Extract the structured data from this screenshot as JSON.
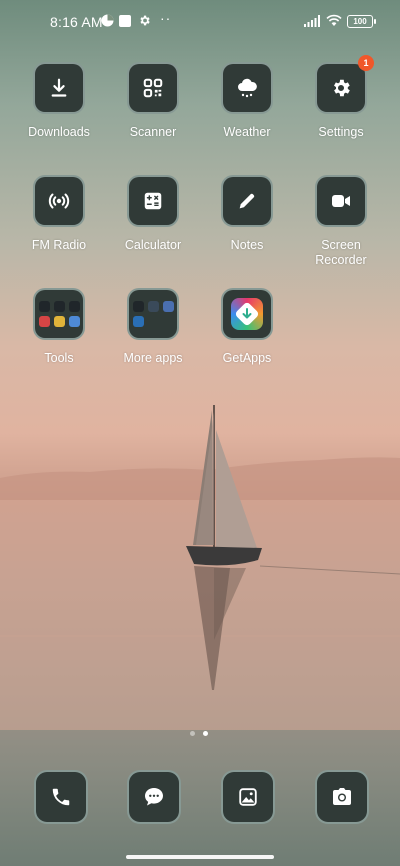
{
  "status_bar": {
    "time": "8:16 AM",
    "battery": "100",
    "more": "··"
  },
  "apps": {
    "row1": [
      {
        "label": "Downloads",
        "icon": "download-icon"
      },
      {
        "label": "Scanner",
        "icon": "qr-scanner-icon"
      },
      {
        "label": "Weather",
        "icon": "weather-cloud-icon"
      },
      {
        "label": "Settings",
        "icon": "gear-icon",
        "badge": "1"
      }
    ],
    "row2": [
      {
        "label": "FM Radio",
        "icon": "radio-icon"
      },
      {
        "label": "Calculator",
        "icon": "calculator-icon"
      },
      {
        "label": "Notes",
        "icon": "pencil-icon"
      },
      {
        "label": "Screen\nRecorder",
        "label_line1": "Screen",
        "label_line2": "Recorder",
        "icon": "video-camera-icon"
      }
    ],
    "row3": [
      {
        "label": "Tools",
        "icon": "folder-icon"
      },
      {
        "label": "More apps",
        "icon": "folder-icon"
      },
      {
        "label": "GetApps",
        "icon": "getapps-icon"
      }
    ]
  },
  "pager": {
    "pages": 2,
    "current": 2
  },
  "dock": [
    {
      "icon": "phone-icon"
    },
    {
      "icon": "message-icon"
    },
    {
      "icon": "gallery-icon"
    },
    {
      "icon": "camera-icon"
    }
  ],
  "colors": {
    "tile_bg": "#303a37",
    "badge": "#f0572a"
  }
}
